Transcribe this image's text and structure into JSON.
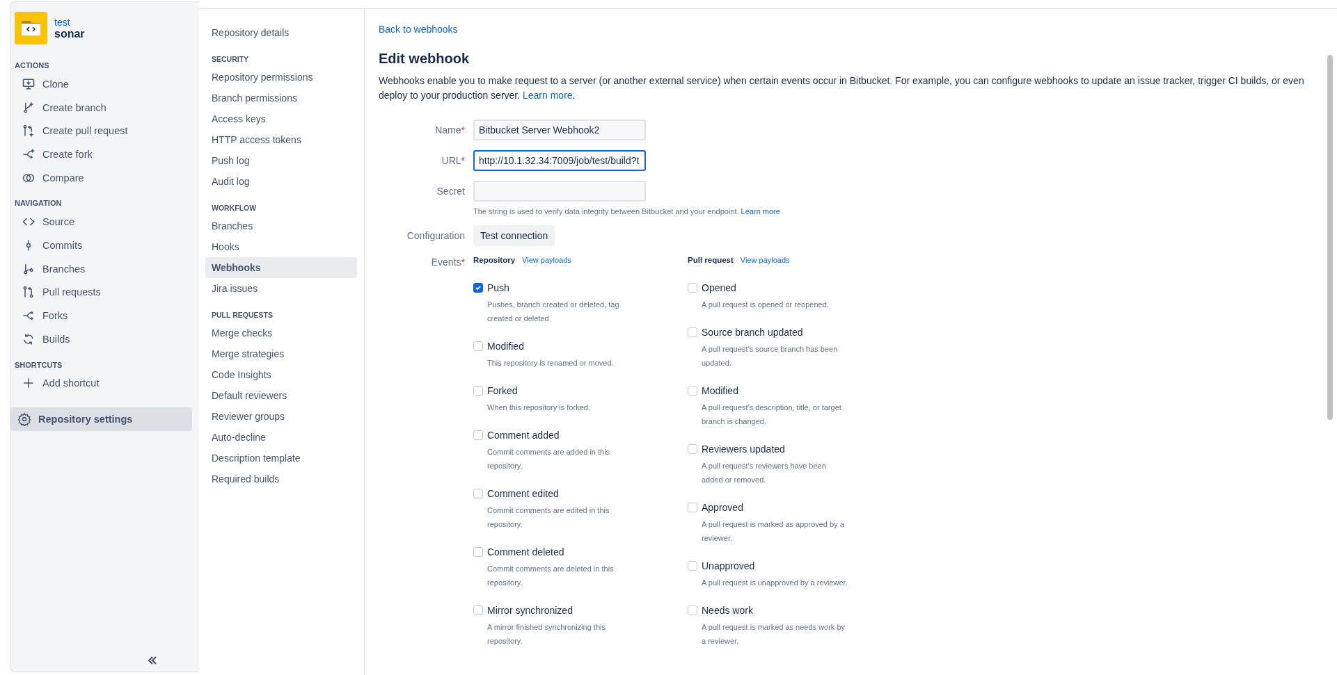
{
  "repository": {
    "project": "test",
    "name": "sonar"
  },
  "sidebar": {
    "sections": [
      {
        "heading": "ACTIONS",
        "items": [
          {
            "label": "Clone",
            "selected": false
          },
          {
            "label": "Create branch",
            "selected": false
          },
          {
            "label": "Create pull request",
            "selected": false
          },
          {
            "label": "Create fork",
            "selected": false
          },
          {
            "label": "Compare",
            "selected": false
          }
        ]
      },
      {
        "heading": "NAVIGATION",
        "items": [
          {
            "label": "Source",
            "selected": false
          },
          {
            "label": "Commits",
            "selected": false
          },
          {
            "label": "Branches",
            "selected": false
          },
          {
            "label": "Pull requests",
            "selected": false
          },
          {
            "label": "Forks",
            "selected": false
          },
          {
            "label": "Builds",
            "selected": false
          }
        ]
      },
      {
        "heading": "SHORTCUTS",
        "items": [
          {
            "label": "Add shortcut",
            "selected": false
          }
        ]
      }
    ],
    "settings_button": {
      "label": "Repository settings",
      "selected": true
    }
  },
  "settings_nav": {
    "sections": [
      {
        "items": [
          {
            "label": "Repository details",
            "selected": false
          }
        ]
      },
      {
        "heading": "SECURITY",
        "items": [
          {
            "label": "Repository permissions",
            "selected": false
          },
          {
            "label": "Branch permissions",
            "selected": false
          },
          {
            "label": "Access keys",
            "selected": false
          },
          {
            "label": "HTTP access tokens",
            "selected": false
          },
          {
            "label": "Push log",
            "selected": false
          },
          {
            "label": "Audit log",
            "selected": false
          }
        ]
      },
      {
        "heading": "WORKFLOW",
        "items": [
          {
            "label": "Branches",
            "selected": false
          },
          {
            "label": "Hooks",
            "selected": false
          },
          {
            "label": "Webhooks",
            "selected": true
          },
          {
            "label": "Jira issues",
            "selected": false
          }
        ]
      },
      {
        "heading": "PULL REQUESTS",
        "items": [
          {
            "label": "Merge checks",
            "selected": false
          },
          {
            "label": "Merge strategies",
            "selected": false
          },
          {
            "label": "Code Insights",
            "selected": false
          },
          {
            "label": "Default reviewers",
            "selected": false
          },
          {
            "label": "Reviewer groups",
            "selected": false
          },
          {
            "label": "Auto-decline",
            "selected": false
          },
          {
            "label": "Description template",
            "selected": false
          },
          {
            "label": "Required builds",
            "selected": false
          }
        ]
      }
    ]
  },
  "back_link": "Back to webhooks",
  "title": "Edit webhook",
  "description": {
    "text": "Webhooks enable you to make request to a server (or another external service) when certain events occur in Bitbucket. For example, you can configure webhooks to update an issue tracker, trigger CI builds, or even deploy to your production server. ",
    "link": "Learn more",
    "after": "."
  },
  "fields": [
    {
      "label": "Name",
      "required_mark": "*",
      "value": "Bitbucket Server Webhook2",
      "focused": false
    },
    {
      "label": "URL",
      "required_mark": "*",
      "value": "http://10.1.32.34:7009/job/test/build?t",
      "focused": true
    },
    {
      "label": "Secret",
      "focused": false,
      "hint": "The string is used to verify data integrity between Bitbucket and your endpoint. ",
      "hint_link": "Learn more"
    }
  ],
  "configuration": {
    "label": "Configuration",
    "button": "Test connection"
  },
  "events": {
    "label": "Events",
    "required_mark": "*",
    "columns": [
      {
        "heading": "Repository",
        "link": "View payloads",
        "events": [
          {
            "label": "Push",
            "description": "Pushes, branch created or deleted, tag created or deleted",
            "checked": true
          },
          {
            "label": "Modified",
            "description": "This repository is renamed or moved.",
            "checked": false
          },
          {
            "label": "Forked",
            "description": "When this repository is forked.",
            "checked": false
          },
          {
            "label": "Comment added",
            "description": "Commit comments are added in this repository.",
            "checked": false
          },
          {
            "label": "Comment edited",
            "description": "Commit comments are edited in this repository.",
            "checked": false
          },
          {
            "label": "Comment deleted",
            "description": "Commit comments are deleted in this repository.",
            "checked": false
          },
          {
            "label": "Mirror synchronized",
            "description": "A mirror finished synchronizing this repository.",
            "checked": false
          }
        ]
      },
      {
        "heading": "Pull request",
        "link": "View payloads",
        "events": [
          {
            "label": "Opened",
            "description": "A pull request is opened or reopened.",
            "checked": false
          },
          {
            "label": "Source branch updated",
            "description": "A pull request's source branch has been updated.",
            "checked": false
          },
          {
            "label": "Modified",
            "description": "A pull request's description, title, or target branch is changed.",
            "checked": false
          },
          {
            "label": "Reviewers updated",
            "description": "A pull request's reviewers have been added or removed.",
            "checked": false
          },
          {
            "label": "Approved",
            "description": "A pull request is marked as approved by a reviewer.",
            "checked": false
          },
          {
            "label": "Unapproved",
            "description": "A pull request is unapproved by a reviewer.",
            "checked": false
          },
          {
            "label": "Needs work",
            "description": "A pull request is marked as needs work by a reviewer.",
            "checked": false
          }
        ]
      }
    ]
  }
}
